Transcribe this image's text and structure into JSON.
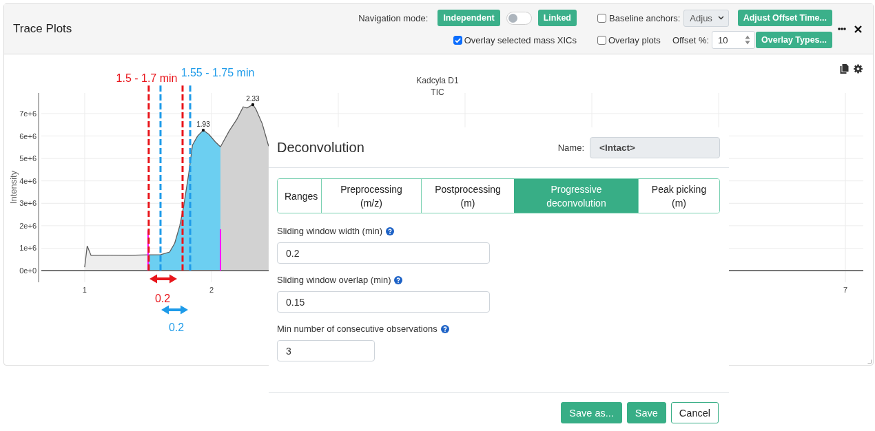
{
  "panel": {
    "title": "Trace Plots",
    "toolbar": {
      "navigation_label": "Navigation mode:",
      "navigation_modes": [
        {
          "label": "Independent"
        },
        {
          "label": "Linked"
        }
      ],
      "link_toggle": {
        "on": false
      },
      "baseline_anchors": {
        "label": "Baseline anchors:",
        "checked": false,
        "select_value": "Adjus"
      },
      "adjust_offset_button": "Adjust Offset Time...",
      "overlay_xics": {
        "label": "Overlay selected mass XICs",
        "checked": true
      },
      "overlay_plots": {
        "label": "Overlay plots",
        "checked": false
      },
      "offset": {
        "label": "Offset %:",
        "value": "10"
      },
      "overlay_types_button": "Overlay Types..."
    }
  },
  "chart": {
    "window_markers": [
      {
        "label": "1.5 - 1.7 min",
        "width_label": "0.2",
        "color": "#e8151b"
      },
      {
        "label": "1.55 - 1.75 min",
        "width_label": "0.2",
        "color": "#1e9be9"
      }
    ],
    "chart_data": {
      "type": "area",
      "title": "Kadcyla D1",
      "subtitle": "TIC",
      "ylabel": "Intensity",
      "xlim": [
        0.658,
        7.141
      ],
      "ylim": [
        -520000,
        7920000
      ],
      "xticks": [
        1,
        2,
        7
      ],
      "yticks": [
        {
          "value": 0,
          "label": "0e+0"
        },
        {
          "value": 1000000,
          "label": "1e+6"
        },
        {
          "value": 2000000,
          "label": "2e+6"
        },
        {
          "value": 3000000,
          "label": "3e+6"
        },
        {
          "value": 4000000,
          "label": "4e+6"
        },
        {
          "value": 5000000,
          "label": "5e+6"
        },
        {
          "value": 6000000,
          "label": "6e+6"
        },
        {
          "value": 7000000,
          "label": "7e+6"
        }
      ],
      "grid": true,
      "x": [
        1.0,
        1.02,
        1.05,
        1.2,
        1.35,
        1.5,
        1.6,
        1.67,
        1.71,
        1.75,
        1.78,
        1.82,
        1.85,
        1.89,
        1.935,
        1.98,
        2.03,
        2.071,
        2.14,
        2.2,
        2.25,
        2.28,
        2.326,
        2.35,
        2.4,
        2.451
      ],
      "series": [
        {
          "color": "#eeeeee",
          "values": [
            150000,
            1100000,
            680000,
            690000,
            680000,
            700000,
            null,
            null,
            null,
            null,
            null,
            null,
            null,
            null,
            null,
            null,
            null,
            null,
            null,
            null,
            null,
            null,
            null,
            null,
            null,
            null
          ]
        },
        {
          "color": "#6ccff1",
          "values": [
            null,
            null,
            null,
            null,
            null,
            700000,
            710000,
            830000,
            1220000,
            2000000,
            2850000,
            4300000,
            5600000,
            6000000,
            6260000,
            6070000,
            5740000,
            5520000,
            null,
            null,
            null,
            null,
            null,
            null,
            null,
            null
          ]
        },
        {
          "color": "#d2d2d2",
          "values": [
            null,
            null,
            null,
            null,
            null,
            null,
            null,
            null,
            null,
            null,
            null,
            null,
            null,
            null,
            null,
            null,
            null,
            5520000,
            6230000,
            6750000,
            7300000,
            7250000,
            7400000,
            7200000,
            6550000,
            5550000
          ]
        }
      ],
      "ref_lines": [
        {
          "axis": "x",
          "value": 1.5,
          "color": "#ff00ff"
        },
        {
          "axis": "x",
          "value": 1.505,
          "color": "#e8151b"
        },
        {
          "axis": "x",
          "value": 1.598,
          "color": "#1e9be9"
        },
        {
          "axis": "x",
          "value": 1.772,
          "color": "#e8151b"
        },
        {
          "axis": "x",
          "value": 1.832,
          "color": "#1e9be9"
        },
        {
          "axis": "x",
          "value": 2.071,
          "color": "#ff00ff"
        }
      ],
      "annotations": [
        {
          "text": "1.93",
          "x": 1.935,
          "y": 6260000
        },
        {
          "text": "2.33",
          "x": 2.326,
          "y": 7400000
        }
      ]
    }
  },
  "dialog": {
    "title": "Deconvolution",
    "name_label": "Name:",
    "name_value": "<Intact>",
    "tabs": [
      {
        "label": "Ranges",
        "selected": false
      },
      {
        "label": "Preprocessing (m/z)",
        "selected": false
      },
      {
        "label": "Postprocessing (m)",
        "selected": false
      },
      {
        "label": "Progressive deconvolution",
        "selected": true
      },
      {
        "label": "Peak picking (m)",
        "selected": false
      }
    ],
    "fields": [
      {
        "label": "Sliding window width (min)",
        "help": true,
        "value": "0.2"
      },
      {
        "label": "Sliding window overlap (min)",
        "help": true,
        "value": "0.15"
      },
      {
        "label": "Min number of consecutive observations",
        "help": true,
        "value": "3"
      }
    ],
    "buttons": [
      {
        "label": "Save as...",
        "kind": "primary"
      },
      {
        "label": "Save",
        "kind": "primary"
      },
      {
        "label": "Cancel",
        "kind": "secondary"
      }
    ]
  }
}
